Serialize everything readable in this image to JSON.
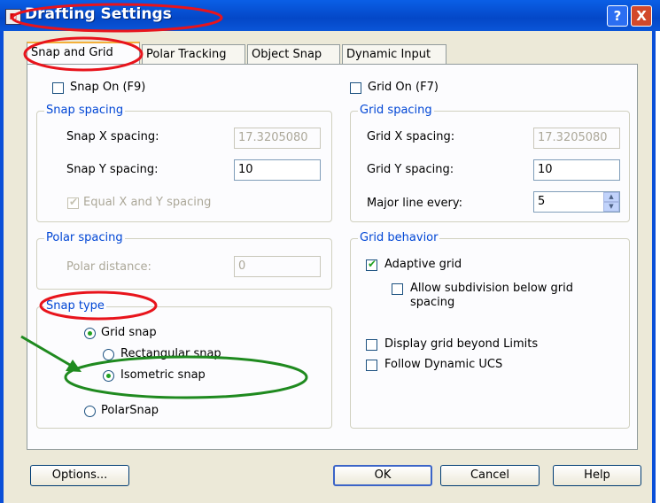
{
  "window": {
    "title": "Drafting Settings",
    "help_label": "?",
    "close_label": "X"
  },
  "tabs": [
    {
      "label": "Snap and Grid",
      "active": true
    },
    {
      "label": "Polar Tracking",
      "active": false
    },
    {
      "label": "Object Snap",
      "active": false
    },
    {
      "label": "Dynamic Input",
      "active": false
    }
  ],
  "snap": {
    "on_label": "Snap On (F9)",
    "on_checked": false,
    "spacing_legend": "Snap spacing",
    "x_label": "Snap X spacing:",
    "x_value": "17.3205080",
    "y_label": "Snap Y spacing:",
    "y_value": "10",
    "equal_label": "Equal X and Y spacing",
    "equal_checked": true
  },
  "polar": {
    "legend": "Polar spacing",
    "distance_label": "Polar distance:",
    "distance_value": "0"
  },
  "snap_type": {
    "legend": "Snap type",
    "grid_snap": "Grid snap",
    "rectangular": "Rectangular snap",
    "isometric": "Isometric snap",
    "polar_snap": "PolarSnap",
    "selected": "isometric"
  },
  "grid": {
    "on_label": "Grid On (F7)",
    "on_checked": false,
    "spacing_legend": "Grid spacing",
    "x_label": "Grid X spacing:",
    "x_value": "17.3205080",
    "y_label": "Grid Y spacing:",
    "y_value": "10",
    "major_label": "Major line every:",
    "major_value": "5"
  },
  "grid_behavior": {
    "legend": "Grid behavior",
    "adaptive": "Adaptive grid",
    "adaptive_checked": true,
    "subdivision_line1": "Allow subdivision below grid",
    "subdivision_line2": "spacing",
    "subdivision_checked": false,
    "beyond_limits": "Display grid beyond Limits",
    "beyond_checked": false,
    "dynamic_ucs": "Follow Dynamic UCS",
    "ucs_checked": false
  },
  "buttons": {
    "options": "Options...",
    "ok": "OK",
    "cancel": "Cancel",
    "help": "Help"
  },
  "colors": {
    "title_bar": "#0a5fe6",
    "group_legend": "#0046d5",
    "annotation_red": "#e8141c",
    "annotation_green": "#1f8a1f"
  }
}
